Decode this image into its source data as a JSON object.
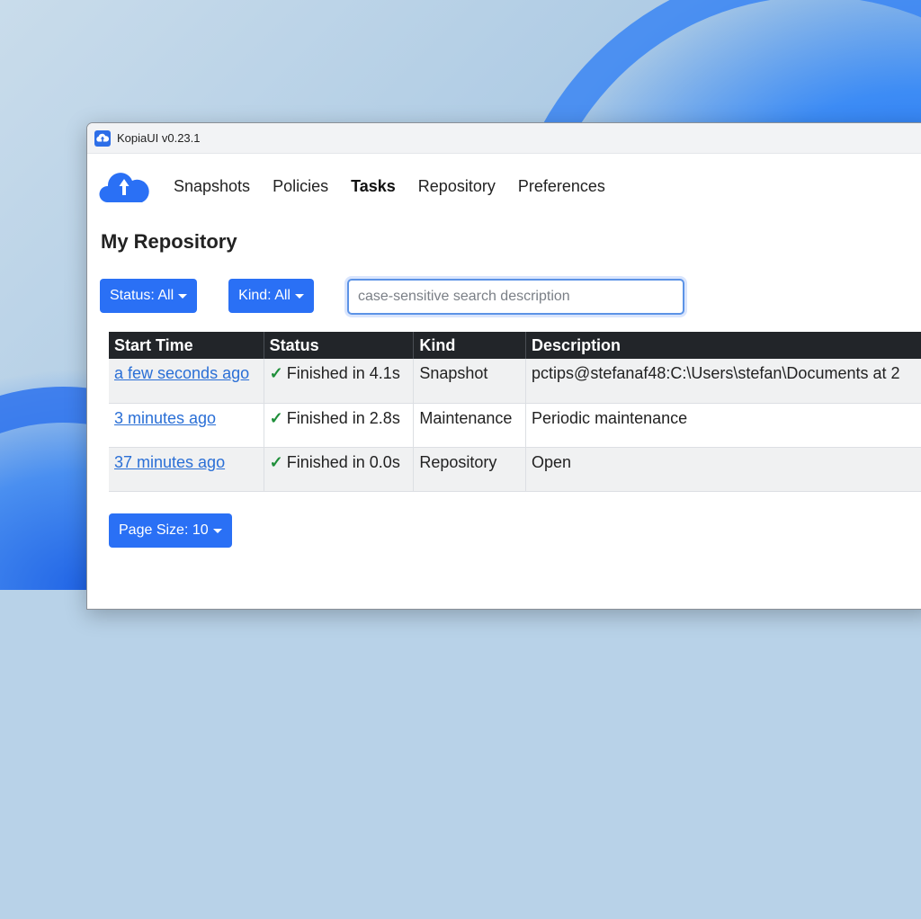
{
  "window": {
    "title": "KopiaUI v0.23.1"
  },
  "nav": {
    "items": [
      {
        "label": "Snapshots"
      },
      {
        "label": "Policies"
      },
      {
        "label": "Tasks",
        "active": true
      },
      {
        "label": "Repository"
      },
      {
        "label": "Preferences"
      }
    ]
  },
  "page": {
    "title": "My Repository"
  },
  "filters": {
    "status_label": "Status: All",
    "kind_label": "Kind: All",
    "search_placeholder": "case-sensitive search description",
    "search_value": ""
  },
  "table": {
    "columns": [
      "Start Time",
      "Status",
      "Kind",
      "Description"
    ],
    "rows": [
      {
        "start_time": "a few seconds ago",
        "status": "Finished in 4.1s",
        "kind": "Snapshot",
        "description": "pctips@stefanaf48:C:\\Users\\stefan\\Documents at 2"
      },
      {
        "start_time": "3 minutes ago",
        "status": "Finished in 2.8s",
        "kind": "Maintenance",
        "description": "Periodic maintenance"
      },
      {
        "start_time": "37 minutes ago",
        "status": "Finished in 0.0s",
        "kind": "Repository",
        "description": "Open"
      }
    ]
  },
  "pagination": {
    "page_size_label": "Page Size: 10"
  },
  "colors": {
    "accent": "#2a70f5",
    "header_bg": "#222529",
    "success": "#1f8f3a",
    "link": "#2a6fd6"
  },
  "icons": {
    "app": "kopia-cloud-icon",
    "logo": "kopia-cloud-logo",
    "status_ok": "check-icon"
  }
}
